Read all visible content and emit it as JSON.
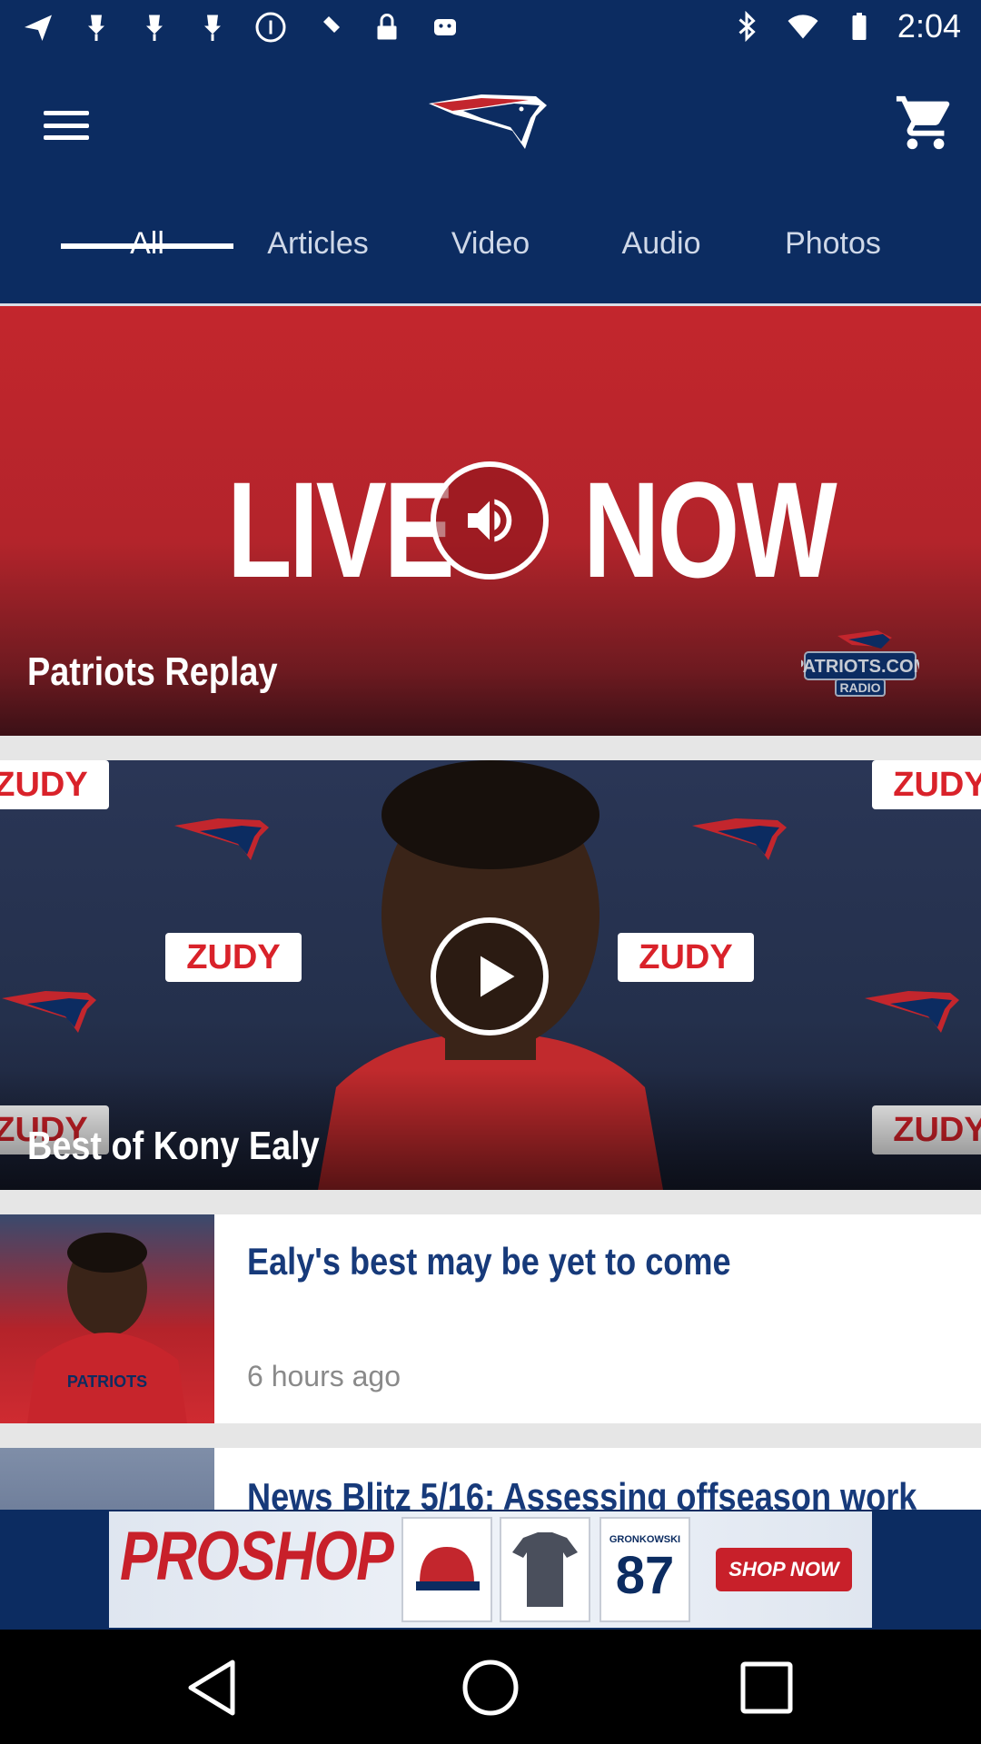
{
  "status_bar": {
    "time": "2:04",
    "left_icons": [
      "navigation-icon",
      "notification-icon",
      "notification-icon",
      "notification-icon",
      "info-icon",
      "fake-gps-icon",
      "lock-icon",
      "android-icon"
    ],
    "right_icons": [
      "bluetooth-icon",
      "wifi-icon",
      "battery-icon"
    ]
  },
  "header": {
    "menu_icon": "hamburger-menu-icon",
    "logo": "patriots-logo",
    "cart_icon": "shopping-cart-icon",
    "colors": {
      "navy": "#0c2c61",
      "red": "#c3262d"
    }
  },
  "tabs": [
    {
      "label": "All",
      "active": true
    },
    {
      "label": "Articles",
      "active": false
    },
    {
      "label": "Video",
      "active": false
    },
    {
      "label": "Audio",
      "active": false
    },
    {
      "label": "Photos",
      "active": false
    }
  ],
  "feed": {
    "live_card": {
      "live_word": "LIVE",
      "now_word": "NOW",
      "title": "Patriots Replay",
      "badge_line1": "PATRIOTS.COM",
      "badge_line2": "RADIO"
    },
    "video_card": {
      "title": "Best of Kony Ealy",
      "sponsor_text": "ZUDY"
    },
    "articles": [
      {
        "title": "Ealy's best may be yet to come",
        "time": "6 hours ago"
      },
      {
        "title": "News Blitz 5/16: Assessing offseason work"
      }
    ]
  },
  "banner": {
    "brand": "PROSHOP",
    "jersey_name": "GRONKOWSKI",
    "jersey_number": "87",
    "cta": "SHOP NOW"
  }
}
